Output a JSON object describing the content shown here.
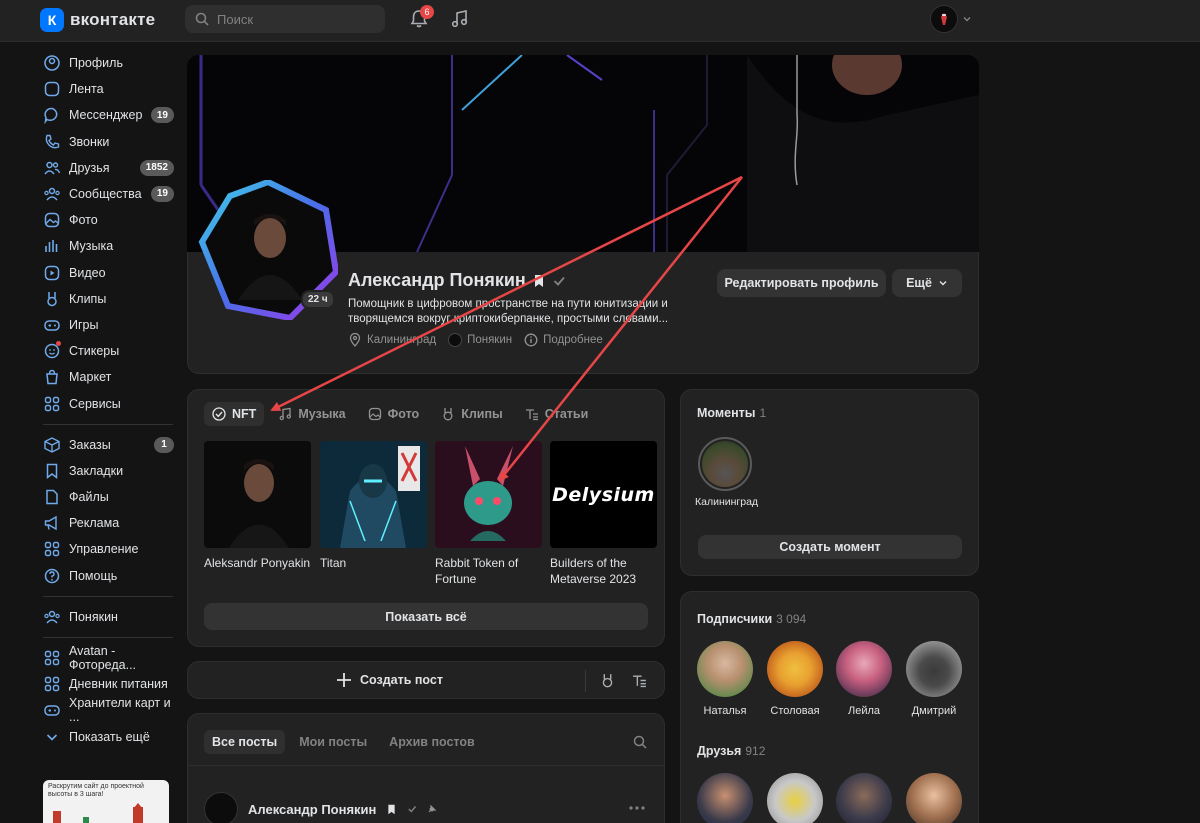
{
  "app": {
    "logo_text": "вконтакте",
    "logo_letter": "К"
  },
  "search": {
    "placeholder": "Поиск"
  },
  "notifications": {
    "count": "6"
  },
  "sidebar": {
    "items": [
      {
        "label": "Профиль",
        "icon": "profile-icon"
      },
      {
        "label": "Лента",
        "icon": "feed-icon"
      },
      {
        "label": "Мессенджер",
        "icon": "messenger-icon",
        "badge": "19"
      },
      {
        "label": "Звонки",
        "icon": "phone-icon"
      },
      {
        "label": "Друзья",
        "icon": "friends-icon",
        "badge": "1852"
      },
      {
        "label": "Сообщества",
        "icon": "communities-icon",
        "badge": "19"
      },
      {
        "label": "Фото",
        "icon": "photo-icon"
      },
      {
        "label": "Музыка",
        "icon": "music-icon"
      },
      {
        "label": "Видео",
        "icon": "video-icon"
      },
      {
        "label": "Клипы",
        "icon": "clips-icon"
      },
      {
        "label": "Игры",
        "icon": "games-icon"
      },
      {
        "label": "Стикеры",
        "icon": "stickers-icon"
      },
      {
        "label": "Маркет",
        "icon": "market-icon"
      },
      {
        "label": "Сервисы",
        "icon": "services-icon"
      }
    ],
    "items2": [
      {
        "label": "Заказы",
        "icon": "orders-icon",
        "badge": "1"
      },
      {
        "label": "Закладки",
        "icon": "bookmarks-icon"
      },
      {
        "label": "Файлы",
        "icon": "files-icon"
      },
      {
        "label": "Реклама",
        "icon": "ads-icon"
      },
      {
        "label": "Управление",
        "icon": "manage-icon"
      },
      {
        "label": "Помощь",
        "icon": "help-icon"
      }
    ],
    "items3": [
      {
        "label": "Понякин",
        "icon": "community-icon"
      }
    ],
    "items4": [
      {
        "label": "Avatan - Фотореда...",
        "icon": "app-icon"
      },
      {
        "label": "Дневник питания",
        "icon": "app-icon"
      },
      {
        "label": "Хранители карт и ...",
        "icon": "games-icon"
      },
      {
        "label": "Показать ещё",
        "icon": "chevron-down-icon"
      }
    ],
    "ad_text": "Раскрутим сайт до проектной высоты в 3 шага!"
  },
  "profile": {
    "name": "Александр Понякин",
    "status": "Помощник в цифровом пространстве на пути юнитизации и творящемся вокруг криптокиберпанке, простыми словами...",
    "avatar_time": "22 ч",
    "city": "Калининград",
    "community": "Понякин",
    "more_info": "Подробнее",
    "edit_button": "Редактировать профиль",
    "more_button": "Ещё"
  },
  "media_tabs": [
    "NFT",
    "Музыка",
    "Фото",
    "Клипы",
    "Статьи"
  ],
  "nft": [
    {
      "title": "Aleksandr Ponyakin"
    },
    {
      "title": "Titan"
    },
    {
      "title": "Rabbit Token of Fortune"
    },
    {
      "title": "Builders of the Metaverse 2023"
    }
  ],
  "nft_logo_text": "Delysium",
  "show_all": "Показать всё",
  "create_post": "Создать пост",
  "post_filters": [
    "Все посты",
    "Мои посты",
    "Архив постов"
  ],
  "post": {
    "author": "Александр Понякин"
  },
  "moments": {
    "title": "Моменты",
    "count": "1",
    "item_label": "Калининград",
    "create_button": "Создать момент"
  },
  "followers": {
    "title": "Подписчики",
    "count": "3 094",
    "people": [
      "Наталья",
      "Столовая",
      "Лейла",
      "Дмитрий"
    ]
  },
  "friends": {
    "title": "Друзья",
    "count": "912"
  },
  "colors": {
    "accent": "#71aaeb",
    "annotation": "#e64646",
    "card": "#222222",
    "background": "#141414"
  }
}
